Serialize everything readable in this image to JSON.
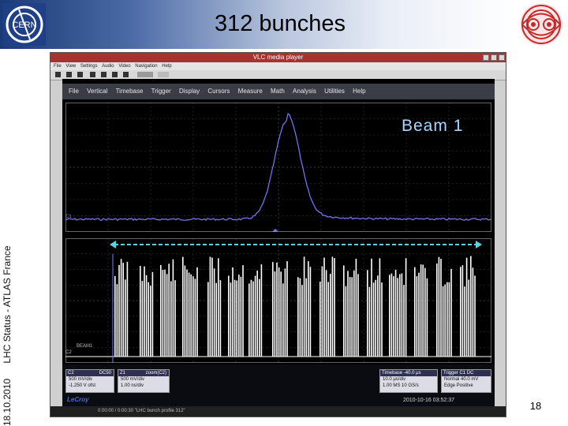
{
  "slide": {
    "title": "312 bunches",
    "side_date": "18.10.2010",
    "side_text": "LHC Status - ATLAS France",
    "page_number": "18"
  },
  "vlc": {
    "title": "VLC media player",
    "menu": [
      "File",
      "View",
      "Settings",
      "Audio",
      "Video",
      "Navigation",
      "Help"
    ],
    "footer": "0:00:00 / 0:00:30  \"LHC bunch profile 312\""
  },
  "scope": {
    "menu": [
      "File",
      "Vertical",
      "Timebase",
      "Trigger",
      "Display",
      "Cursors",
      "Measure",
      "Math",
      "Analysis",
      "Utilities",
      "Help"
    ],
    "beam_label": "Beam 1",
    "trace_top_label": "C1",
    "trace_bottom_label": "C2",
    "bottom_trace_name": "BEAM1",
    "lecroy": "LeCroy",
    "timestamp": "2010-10-16 03:52:37",
    "channel_box_1": {
      "header": "C2",
      "tag": "DC50",
      "rows": [
        "500 mV/div",
        "-1.250 V ofst"
      ]
    },
    "channel_box_2": {
      "header": "Z1",
      "tag": "zoom(C2)",
      "rows": [
        "500 mV/div",
        "1.00 ns/div"
      ]
    },
    "timebase_box": {
      "header": "Timebase -40.0 μs",
      "rows": [
        "10.0 μs/div",
        "1.00 MS    10 GS/s"
      ]
    },
    "trigger_box": {
      "header": "Trigger   C1 DC",
      "rows": [
        "Normal    40.0 mV",
        "Edge    Positive"
      ]
    },
    "colors": {
      "trace_top": "#7b7bff",
      "trace_bottom": "#ffffff",
      "arrow": "#4fd6e8",
      "beam_label": "#a9d6ff",
      "scope_background": "#000000"
    }
  }
}
